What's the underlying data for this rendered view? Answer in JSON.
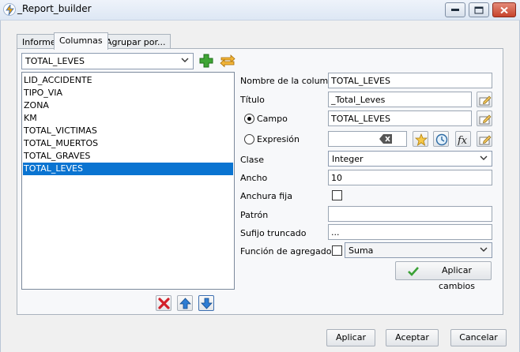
{
  "window": {
    "title": "_Report_builder"
  },
  "tabs": [
    {
      "label": "Informe"
    },
    {
      "label": "Columnas"
    },
    {
      "label": "Agrupar por..."
    }
  ],
  "column_selector": {
    "value": "TOTAL_LEVES"
  },
  "columns_list": [
    "LID_ACCIDENTE",
    "TIPO_VIA",
    "ZONA",
    "KM",
    "TOTAL_VICTIMAS",
    "TOTAL_MUERTOS",
    "TOTAL_GRAVES",
    "TOTAL_LEVES"
  ],
  "selected_column": "TOTAL_LEVES",
  "form": {
    "nombre_columna": {
      "label": "Nombre de la columna",
      "value": "TOTAL_LEVES"
    },
    "titulo": {
      "label": "Título",
      "value": "_Total_Leves"
    },
    "campo": {
      "label": "Campo",
      "value": "TOTAL_LEVES",
      "selected": true
    },
    "expresion": {
      "label": "Expresión",
      "value": ""
    },
    "clase": {
      "label": "Clase",
      "value": "Integer"
    },
    "ancho": {
      "label": "Ancho",
      "value": "10"
    },
    "anchura_fija": {
      "label": "Anchura fija",
      "checked": false
    },
    "patron": {
      "label": "Patrón",
      "value": ""
    },
    "sufijo_truncado": {
      "label": "Sufijo truncado",
      "value": "..."
    },
    "funcion_agregado": {
      "label": "Función de agregado",
      "checked": false,
      "value": "Suma"
    },
    "apply_changes": "Aplicar cambios"
  },
  "footer": {
    "apply": "Aplicar",
    "accept": "Aceptar",
    "cancel": "Cancelar"
  },
  "icons": {
    "add": "plus-icon",
    "swap": "swap-icon",
    "delete": "delete-icon",
    "up": "arrow-up-icon",
    "down": "arrow-down-icon"
  }
}
